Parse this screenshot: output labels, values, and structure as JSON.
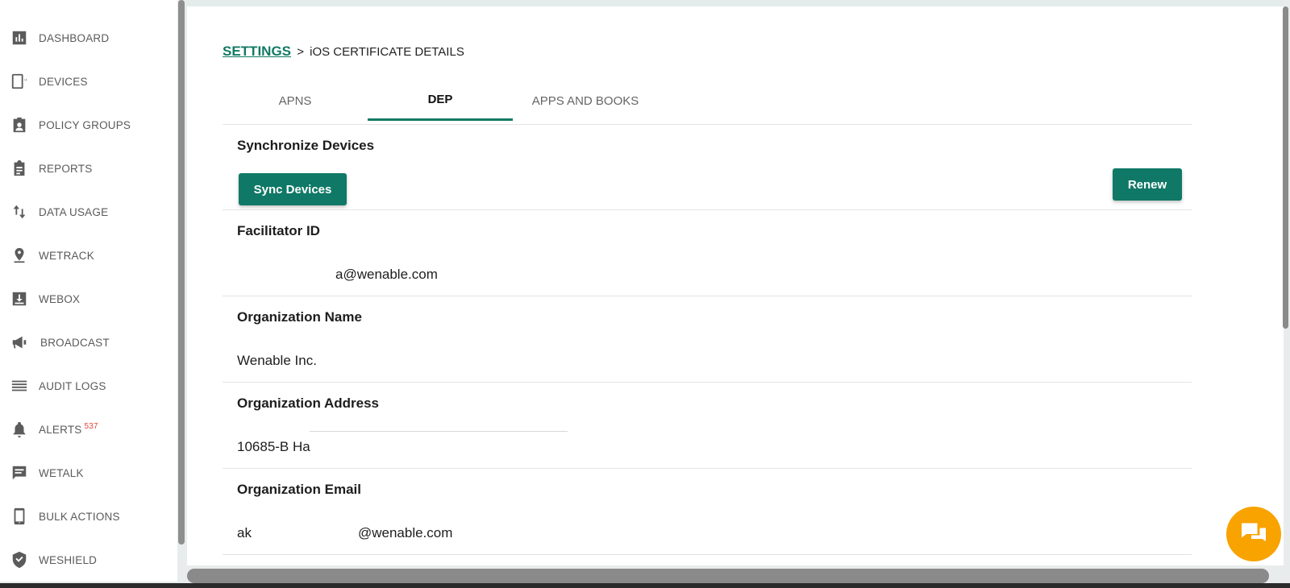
{
  "sidebar": {
    "items": [
      {
        "label": "DASHBOARD",
        "icon": "bar-chart-icon"
      },
      {
        "label": "DEVICES",
        "icon": "device-icon"
      },
      {
        "label": "POLICY GROUPS",
        "icon": "badge-icon"
      },
      {
        "label": "REPORTS",
        "icon": "clipboard-icon"
      },
      {
        "label": "DATA USAGE",
        "icon": "up-down-arrows-icon"
      },
      {
        "label": "WETRACK",
        "icon": "location-pin-icon"
      },
      {
        "label": "WEBOX",
        "icon": "download-box-icon"
      },
      {
        "label": "BROADCAST",
        "icon": "megaphone-icon"
      },
      {
        "label": "AUDIT LOGS",
        "icon": "list-lines-icon"
      },
      {
        "label": "ALERTS",
        "icon": "bell-icon",
        "badge": "537"
      },
      {
        "label": "WETALK",
        "icon": "message-icon"
      },
      {
        "label": "BULK ACTIONS",
        "icon": "phone-icon"
      },
      {
        "label": "WESHIELD",
        "icon": "shield-check-icon"
      }
    ]
  },
  "breadcrumb": {
    "parent": "SETTINGS",
    "separator": ">",
    "current": "iOS CERTIFICATE DETAILS"
  },
  "tabs": [
    {
      "label": "APNS",
      "active": false
    },
    {
      "label": "DEP",
      "active": true
    },
    {
      "label": "APPS AND BOOKS",
      "active": false
    }
  ],
  "sections": {
    "sync": {
      "title": "Synchronize Devices",
      "sync_button": "Sync Devices",
      "renew_button": "Renew"
    },
    "facilitator": {
      "title": "Facilitator ID",
      "value_visible": "a@wenable.com"
    },
    "org_name": {
      "title": "Organization Name",
      "value": "Wenable Inc."
    },
    "org_address": {
      "title": "Organization Address",
      "value_visible": "10685-B Ha"
    },
    "org_email": {
      "title": "Organization Email",
      "value_prefix": "ak",
      "value_suffix": "@wenable.com"
    }
  },
  "colors": {
    "primary": "#0f7866",
    "chat": "#f8a300",
    "badge": "#e0463c"
  }
}
